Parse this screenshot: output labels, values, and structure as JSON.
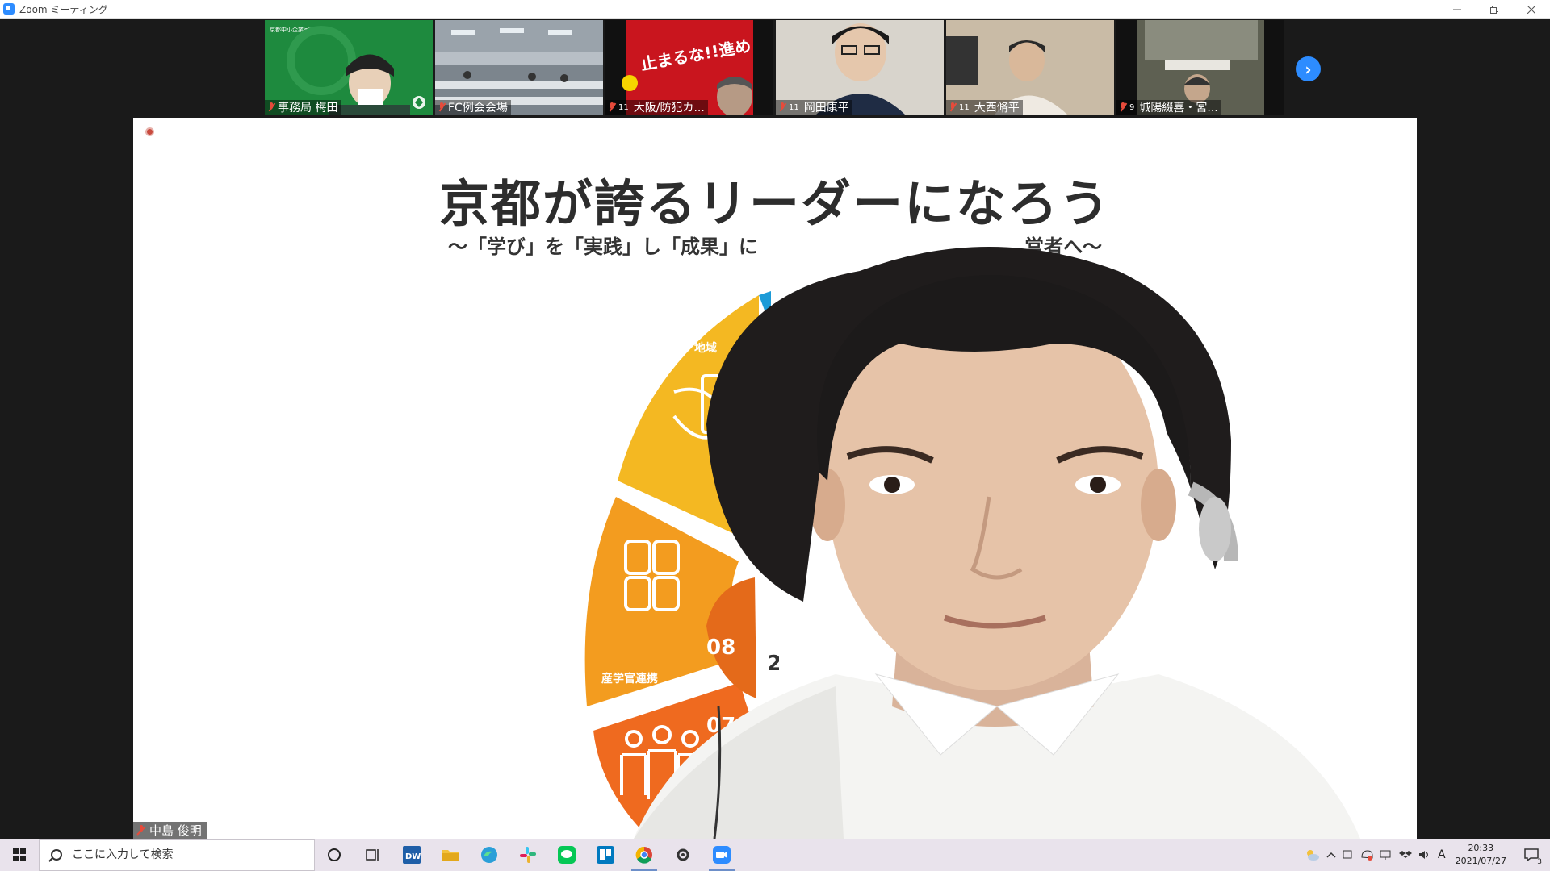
{
  "window": {
    "title": "Zoom ミーティング",
    "controls": [
      "minimize",
      "restore",
      "close"
    ]
  },
  "thumbnails": [
    {
      "name": "事務局 梅田",
      "count": "",
      "muted": true,
      "bg": "#1e8a3e"
    },
    {
      "name": "FC例会会場",
      "count": "",
      "muted": true,
      "bg": "#8f98a2"
    },
    {
      "name": "大阪/防犯カ...",
      "count": "11",
      "muted": true,
      "bg": "#c9151e"
    },
    {
      "name": "岡田康平",
      "count": "11",
      "muted": true,
      "bg": "#d8d4cc"
    },
    {
      "name": "大西脩平",
      "count": "11",
      "muted": true,
      "bg": "#c9bba6"
    },
    {
      "name": "城陽綴喜・宮...",
      "count": "9",
      "muted": true,
      "bg": "#6c6a5e"
    }
  ],
  "slide": {
    "title": "京都が誇るリーダーになろう",
    "subtitle": "～「学び」を「実践」し「成果」に",
    "subtitle_right": "営者へ～",
    "segments": [
      {
        "label": "地域",
        "number": "",
        "color": "#f4b822"
      },
      {
        "label": "産学官連携",
        "number": "08",
        "color": "#f39c1f"
      },
      {
        "label": "",
        "number": "07",
        "color": "#ef6a1f"
      }
    ],
    "center_partial": "2"
  },
  "speaker": {
    "name": "中島 俊明",
    "muted": true
  },
  "taskbar": {
    "search_placeholder": "ここに入力して検索",
    "time": "20:33",
    "date": "2021/07/27",
    "ime": "A",
    "notification_count": "3",
    "apps": [
      "cortana",
      "task-view",
      "dw",
      "file-explorer",
      "edge",
      "slack",
      "line",
      "trello",
      "chrome",
      "settings",
      "zoom"
    ]
  }
}
